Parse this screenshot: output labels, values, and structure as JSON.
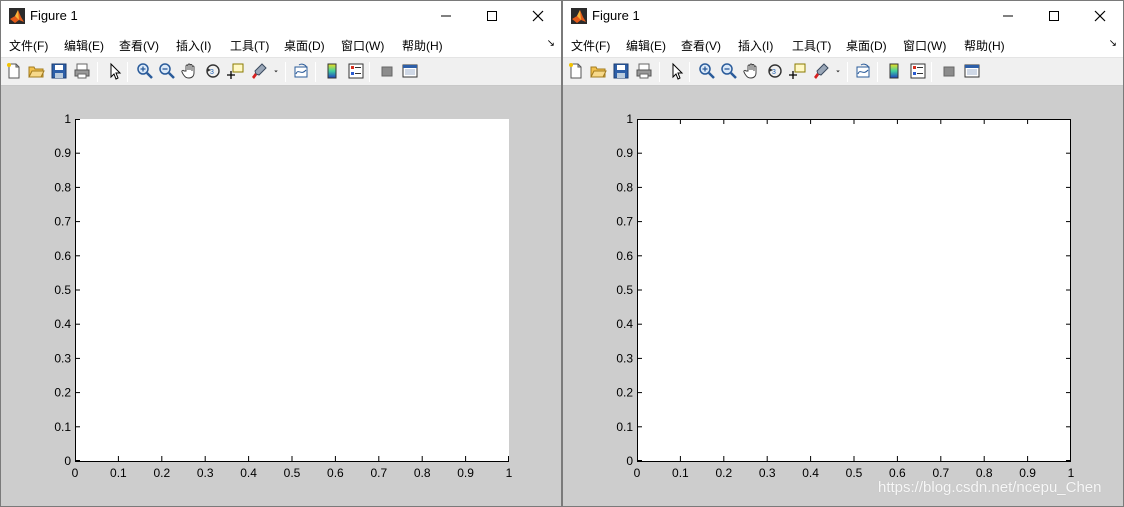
{
  "windows": [
    {
      "id": "left",
      "title": "Figure 1",
      "menu": [
        "文件(F)",
        "编辑(E)",
        "查看(V)",
        "插入(I)",
        "工具(T)",
        "桌面(D)",
        "窗口(W)",
        "帮助(H)"
      ],
      "menu_overflow_glyph": "↘",
      "axes": {
        "xticks": [
          "0",
          "0.1",
          "0.2",
          "0.3",
          "0.4",
          "0.5",
          "0.6",
          "0.7",
          "0.8",
          "0.9",
          "1"
        ],
        "yticks": [
          "0",
          "0.1",
          "0.2",
          "0.3",
          "0.4",
          "0.5",
          "0.6",
          "0.7",
          "0.8",
          "0.9",
          "1"
        ],
        "box": false
      }
    },
    {
      "id": "right",
      "title": "Figure 1",
      "menu": [
        "文件(F)",
        "编辑(E)",
        "查看(V)",
        "插入(I)",
        "工具(T)",
        "桌面(D)",
        "窗口(W)",
        "帮助(H)"
      ],
      "menu_overflow_glyph": "↘",
      "axes": {
        "xticks": [
          "0",
          "0.1",
          "0.2",
          "0.3",
          "0.4",
          "0.5",
          "0.6",
          "0.7",
          "0.8",
          "0.9",
          "1"
        ],
        "yticks": [
          "0",
          "0.1",
          "0.2",
          "0.3",
          "0.4",
          "0.5",
          "0.6",
          "0.7",
          "0.8",
          "0.9",
          "1"
        ],
        "box": true
      }
    }
  ],
  "toolbar_icons": [
    "new-figure-icon",
    "open-file-icon",
    "save-icon",
    "print-icon",
    "edit-plot-arrow-icon",
    "zoom-in-icon",
    "zoom-out-icon",
    "pan-hand-icon",
    "rotate-3d-icon",
    "data-cursor-icon",
    "brush-icon",
    "brush-dropdown-icon",
    "link-plot-icon",
    "insert-colorbar-icon",
    "insert-legend-icon",
    "hide-plot-tools-icon",
    "show-plot-tools-icon"
  ],
  "colors": {
    "figure_bg": "#cdcdcd",
    "axes_bg": "#ffffff",
    "chrome_bg": "#ffffff",
    "toolbar_bg": "#f0f0f0",
    "matlab_orange": "#e25b1a"
  },
  "watermark": "https://blog.csdn.net/ncepu_Chen"
}
